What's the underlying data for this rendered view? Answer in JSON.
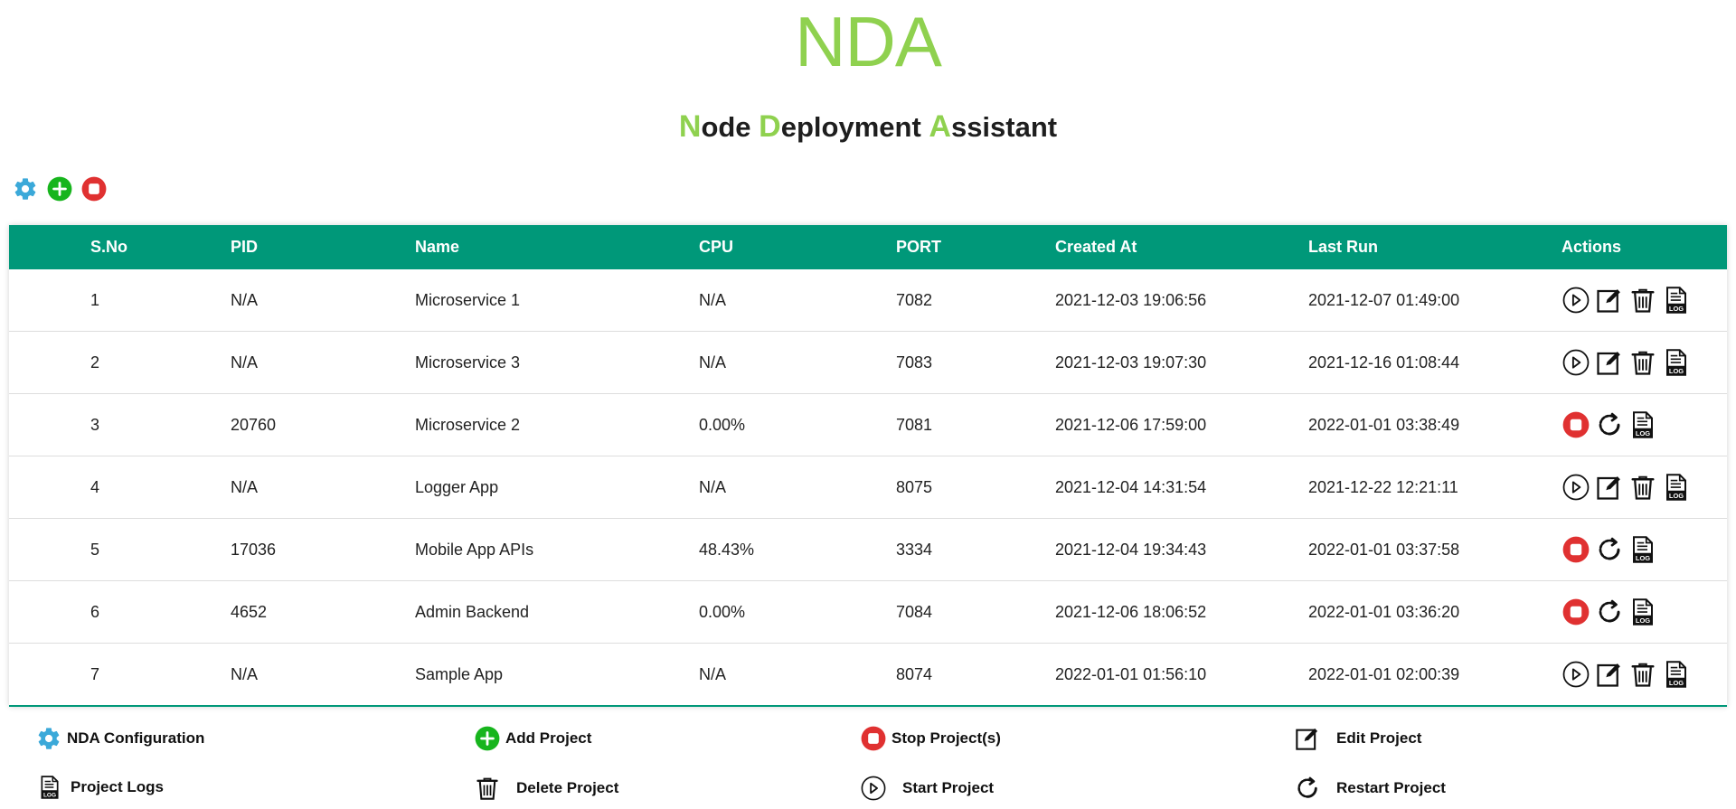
{
  "header": {
    "logo": "NDA",
    "subtitle": [
      {
        "letter": "N",
        "rest": "ode "
      },
      {
        "letter": "D",
        "rest": "eployment "
      },
      {
        "letter": "A",
        "rest": "ssistant"
      }
    ]
  },
  "colors": {
    "brand_green": "#8fd14f",
    "table_header": "#009879",
    "stop_red": "#e03131",
    "add_green": "#17b51d",
    "gear_blue": "#3ba9d9"
  },
  "toolbar": {
    "icons": [
      "gear-icon",
      "add-icon",
      "stop-icon"
    ]
  },
  "table": {
    "columns": [
      "S.No",
      "PID",
      "Name",
      "CPU",
      "PORT",
      "Created At",
      "Last Run",
      "Actions"
    ],
    "rows": [
      {
        "sno": "1",
        "pid": "N/A",
        "name": "Microservice 1",
        "cpu": "N/A",
        "port": "7082",
        "created": "2021-12-03 19:06:56",
        "last_run": "2021-12-07 01:49:00",
        "running": false
      },
      {
        "sno": "2",
        "pid": "N/A",
        "name": "Microservice 3",
        "cpu": "N/A",
        "port": "7083",
        "created": "2021-12-03 19:07:30",
        "last_run": "2021-12-16 01:08:44",
        "running": false
      },
      {
        "sno": "3",
        "pid": "20760",
        "name": "Microservice 2",
        "cpu": "0.00%",
        "port": "7081",
        "created": "2021-12-06 17:59:00",
        "last_run": "2022-01-01 03:38:49",
        "running": true
      },
      {
        "sno": "4",
        "pid": "N/A",
        "name": "Logger App",
        "cpu": "N/A",
        "port": "8075",
        "created": "2021-12-04 14:31:54",
        "last_run": "2021-12-22 12:21:11",
        "running": false
      },
      {
        "sno": "5",
        "pid": "17036",
        "name": "Mobile App APIs",
        "cpu": "48.43%",
        "port": "3334",
        "created": "2021-12-04 19:34:43",
        "last_run": "2022-01-01 03:37:58",
        "running": true
      },
      {
        "sno": "6",
        "pid": "4652",
        "name": "Admin Backend",
        "cpu": "0.00%",
        "port": "7084",
        "created": "2021-12-06 18:06:52",
        "last_run": "2022-01-01 03:36:20",
        "running": true
      },
      {
        "sno": "7",
        "pid": "N/A",
        "name": "Sample App",
        "cpu": "N/A",
        "port": "8074",
        "created": "2022-01-01 01:56:10",
        "last_run": "2022-01-01 02:00:39",
        "running": false
      }
    ]
  },
  "legend": [
    {
      "icon": "gear-icon",
      "label": "NDA Configuration"
    },
    {
      "icon": "add-icon",
      "label": "Add Project"
    },
    {
      "icon": "stop-icon",
      "label": "Stop Project(s)"
    },
    {
      "icon": "edit-icon",
      "label": "Edit Project"
    },
    {
      "icon": "log-icon",
      "label": "Project Logs"
    },
    {
      "icon": "delete-icon",
      "label": "Delete Project"
    },
    {
      "icon": "start-icon",
      "label": "Start Project"
    },
    {
      "icon": "restart-icon",
      "label": "Restart Project"
    }
  ]
}
